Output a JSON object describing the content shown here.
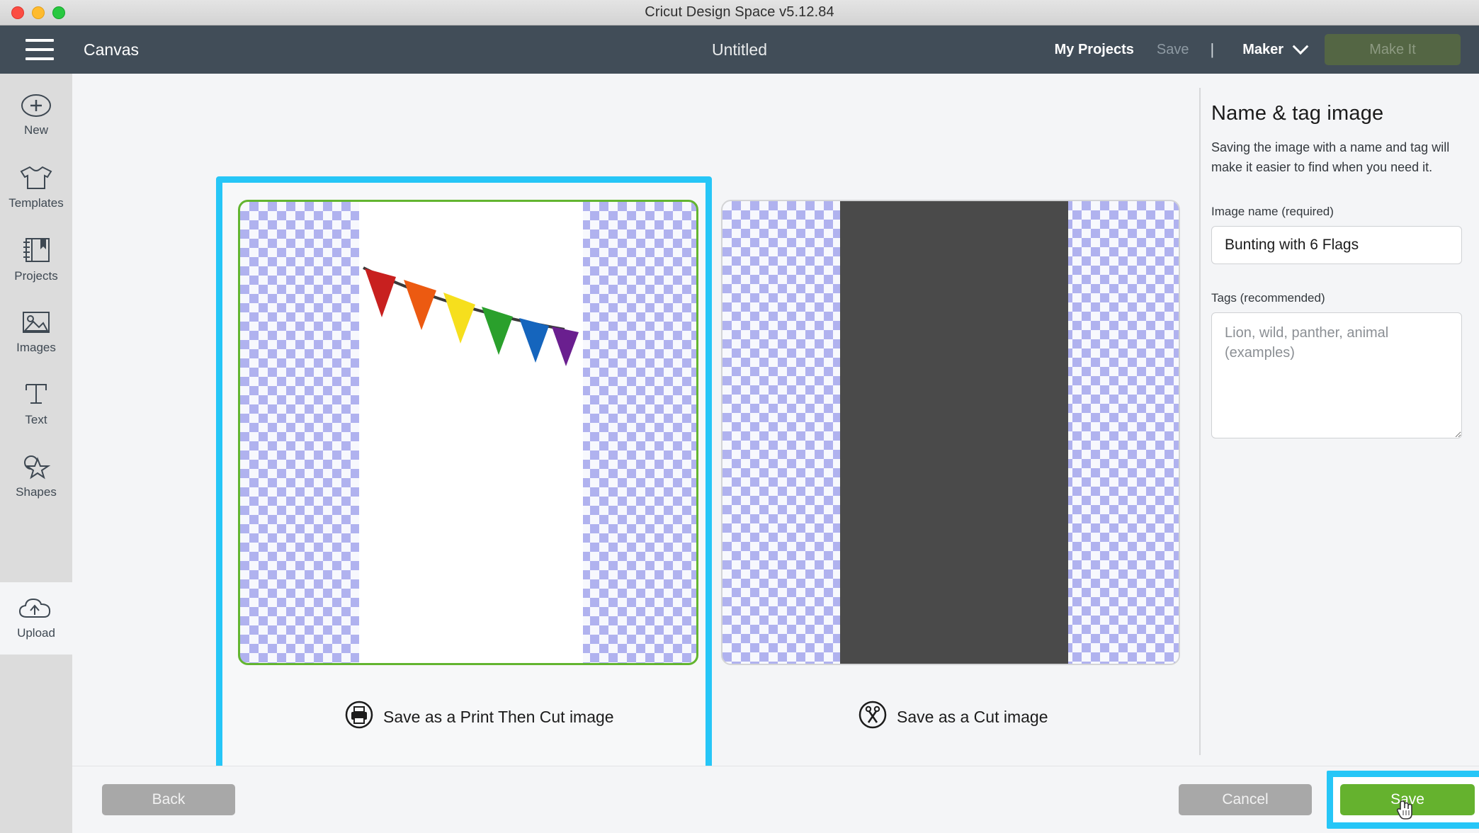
{
  "window": {
    "title": "Cricut Design Space  v5.12.84",
    "traffic_lights": [
      "close-button",
      "minimize-button",
      "zoom-button"
    ]
  },
  "header": {
    "menu_icon": "hamburger-icon",
    "canvas_label": "Canvas",
    "document_title": "Untitled",
    "my_projects": "My Projects",
    "save_link": "Save",
    "separator": "|",
    "machine": "Maker",
    "machine_chevron": "chevron-down-icon",
    "make_it": "Make It"
  },
  "sidebar": {
    "items": [
      {
        "label": "New",
        "icon": "plus-circle-icon",
        "active": false
      },
      {
        "label": "Templates",
        "icon": "tshirt-icon",
        "active": false
      },
      {
        "label": "Projects",
        "icon": "notebook-icon",
        "active": false
      },
      {
        "label": "Images",
        "icon": "picture-icon",
        "active": false
      },
      {
        "label": "Text",
        "icon": "text-t-icon",
        "active": false
      },
      {
        "label": "Shapes",
        "icon": "star-shapes-icon",
        "active": false
      },
      {
        "label": "Upload",
        "icon": "cloud-upload-icon",
        "active": true
      }
    ]
  },
  "main": {
    "options": [
      {
        "id": "print-then-cut",
        "label": "Save as a Print Then Cut image",
        "icon": "printer-circle-icon",
        "selected": true,
        "preview": "colour bunting with 6 triangular flags on a white page over a transparency checkerboard"
      },
      {
        "id": "cut-image",
        "label": "Save as a Cut image",
        "icon": "scissors-circle-icon",
        "selected": false,
        "preview": "solid dark grey silhouette rectangle over a transparency checkerboard"
      }
    ],
    "bunting_flag_colors": [
      "#c8201f",
      "#ec5a11",
      "#f6df1d",
      "#2aa02c",
      "#1565bd",
      "#6a1f8f"
    ],
    "bunting_flag_count": 6
  },
  "panel": {
    "heading": "Name & tag image",
    "description": "Saving the image with a name and tag will make it easier to find when you need it.",
    "name_label": "Image name (required)",
    "name_value": "Bunting with 6 Flags",
    "tags_label": "Tags (recommended)",
    "tags_value": "",
    "tags_placeholder": "Lion, wild, panther, animal (examples)"
  },
  "footer": {
    "back": "Back",
    "cancel": "Cancel",
    "save": "Save"
  },
  "colors": {
    "header_bg": "#414d58",
    "highlight_cyan": "#26c6f7",
    "save_green": "#65b22e",
    "selected_card_border": "#63b530",
    "checker_blue": "#b0b2ef",
    "disabled_gray": "#a8a8a8",
    "silhouette_gray": "#4a4a4a"
  }
}
